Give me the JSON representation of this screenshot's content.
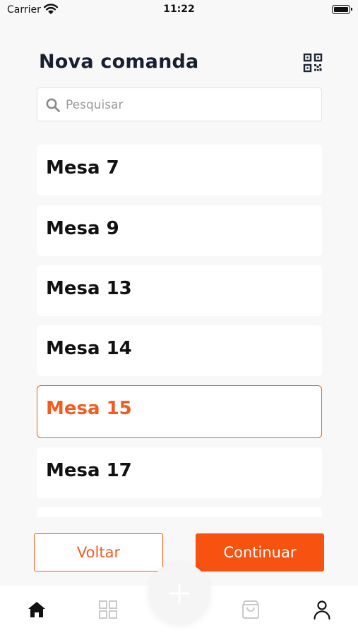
{
  "status_bar": {
    "carrier": "Carrier",
    "time": "11:22"
  },
  "header": {
    "title": "Nova comanda",
    "qr_icon": "qr-code-icon"
  },
  "search": {
    "placeholder": "Pesquisar",
    "value": "",
    "icon": "search-icon"
  },
  "tables": [
    {
      "label": "Mesa 7",
      "selected": false
    },
    {
      "label": "Mesa 9",
      "selected": false
    },
    {
      "label": "Mesa 13",
      "selected": false
    },
    {
      "label": "Mesa 14",
      "selected": false
    },
    {
      "label": "Mesa 15",
      "selected": true
    },
    {
      "label": "Mesa 17",
      "selected": false
    }
  ],
  "actions": {
    "back_label": "Voltar",
    "continue_label": "Continuar"
  },
  "tab_bar": {
    "items": [
      "home-icon",
      "grid-icon",
      "plus-icon",
      "bag-icon",
      "user-icon"
    ],
    "active": "home-icon"
  },
  "colors": {
    "accent": "#f45b1f",
    "title": "#182030",
    "background": "#f8f8f8"
  }
}
